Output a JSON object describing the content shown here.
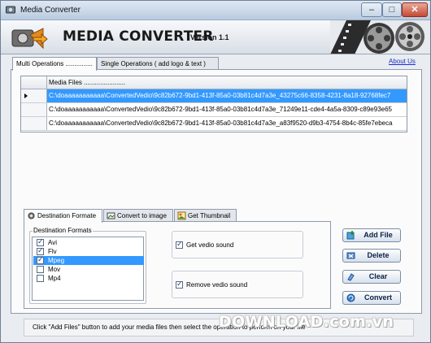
{
  "window": {
    "title": "Media Converter"
  },
  "titlebar_buttons": {
    "minimize": "–",
    "maximize": "□",
    "close": "✕"
  },
  "header": {
    "brand": "MEDIA CONVERTER",
    "version": "Version 1.1"
  },
  "main_tabs": [
    {
      "label": "Multi Operations ...............",
      "active": true
    },
    {
      "label": "Single Operations ( add logo & text )",
      "active": false
    }
  ],
  "about_link": "About Us",
  "grid": {
    "column": "Media Files .......................",
    "rows": [
      {
        "path": "C:\\doaaaaaaaaaaa\\ConvertedVedio\\9c82b672-9bd1-413f-85a0-03b81c4d7a3e_43275c66-8358-4231-8a18-92768fec7",
        "selected": true
      },
      {
        "path": "C:\\doaaaaaaaaaaa\\ConvertedVedio\\9c82b672-9bd1-413f-85a0-03b81c4d7a3e_71249e11-cde4-4a5a-8309-c89e93e65",
        "selected": false
      },
      {
        "path": "C:\\doaaaaaaaaaaa\\ConvertedVedio\\9c82b672-9bd1-413f-85a0-03b81c4d7a3e_a83f9520-d9b3-4754-8b4c-85fe7ebeca",
        "selected": false
      }
    ]
  },
  "sub_tabs": [
    {
      "label": "Destination Formate",
      "icon": "gear-icon",
      "active": true
    },
    {
      "label": "Convert to image",
      "icon": "image-icon",
      "active": false
    },
    {
      "label": "Get Thumbnail",
      "icon": "picture-icon",
      "active": false
    }
  ],
  "destination": {
    "legend": "Destination Formats",
    "formats": [
      {
        "label": "Avi",
        "checked": true,
        "highlighted": false
      },
      {
        "label": "Flv",
        "checked": true,
        "highlighted": false
      },
      {
        "label": "Mpeg",
        "checked": true,
        "highlighted": true
      },
      {
        "label": "Mov",
        "checked": false,
        "highlighted": false
      },
      {
        "label": "Mp4",
        "checked": false,
        "highlighted": false
      }
    ]
  },
  "options": {
    "get_sound": {
      "label": "Get vedio sound",
      "checked": true
    },
    "remove_sound": {
      "label": "Remove vedio sound",
      "checked": true
    }
  },
  "actions": {
    "add_file": "Add File",
    "delete": "Delete",
    "clear": "Clear",
    "convert": "Convert"
  },
  "status": "Click \"Add Files\" button to add your media files  then select the operation to perform on your file",
  "watermark": "DOWNLOAD.com.vn",
  "colors": {
    "selection": "#3399ff",
    "link": "#1a2fc7",
    "close_button": "#c54a33"
  }
}
